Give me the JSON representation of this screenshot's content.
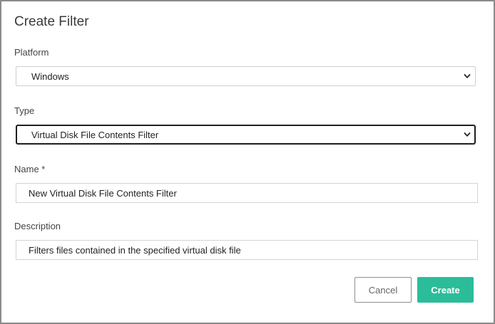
{
  "dialog": {
    "title": "Create Filter"
  },
  "form": {
    "platform": {
      "label": "Platform",
      "value": "Windows"
    },
    "type": {
      "label": "Type",
      "value": "Virtual Disk File Contents Filter"
    },
    "name": {
      "label": "Name *",
      "value": "New Virtual Disk File Contents Filter"
    },
    "description": {
      "label": "Description",
      "value": "Filters files contained in the specified virtual disk file"
    }
  },
  "actions": {
    "cancel_label": "Cancel",
    "create_label": "Create"
  },
  "colors": {
    "accent": "#2bbd99",
    "focus_border": "#1f1f1f",
    "dialog_border": "#8a8a8a"
  },
  "icons": {
    "dropdown": "chevron-down-icon"
  }
}
